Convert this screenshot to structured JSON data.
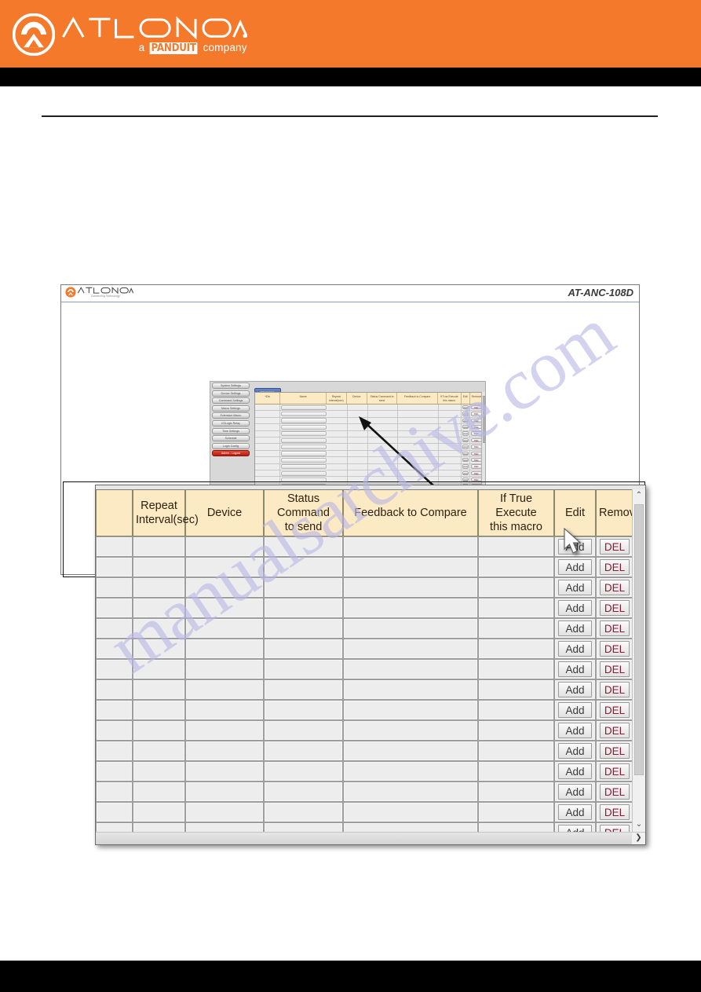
{
  "brand": {
    "logo_name": "atlona-logo",
    "wordmark": "ATLONA",
    "tagline_a": "a",
    "tagline_panduit": "PANDUIT",
    "tagline_company": "company",
    "orange": "#f4792b"
  },
  "watermark": {
    "text": "manualsarchive.com",
    "color": "#b9b7e6"
  },
  "device_ui": {
    "model": "AT-ANC-108D",
    "mini_logo_word": "ATLONA",
    "mini_logo_tagline": "Connecting Technology"
  },
  "inner_app": {
    "sidebar": {
      "items": [
        {
          "label": "System Settings"
        },
        {
          "label": "Device Settings"
        },
        {
          "label": "Command Settings"
        },
        {
          "label": "Macro Settings"
        },
        {
          "label": "Extension Macro"
        },
        {
          "label": "IO/Logic Relay"
        },
        {
          "label": "Time Settings"
        },
        {
          "label": "Schedule"
        },
        {
          "label": "Login Config"
        }
      ],
      "logout": "Admin - Logout"
    },
    "tab": "Message",
    "headers": [
      "+Div",
      "Name",
      "Repeat Interval(sec)",
      "Device",
      "Status Command to send",
      "Feedback to Compare",
      "If True Execute this macro",
      "Edit",
      "Remove"
    ],
    "row_count": 15,
    "add_label": "Add",
    "del_label": "DEL"
  },
  "zoom_panel": {
    "headers": [
      "",
      "Repeat Interval(sec)",
      "Device",
      "Status Command to send",
      "Feedback to Compare",
      "If True Execute this macro",
      "Edit",
      "Remove"
    ],
    "header_lines": [
      [
        "",
        ""
      ],
      [
        "Repeat",
        "Interval(sec)"
      ],
      [
        "Device",
        ""
      ],
      [
        "Status Command",
        "to send"
      ],
      [
        "Feedback to Compare",
        ""
      ],
      [
        "If True Execute",
        "this macro"
      ],
      [
        "Edit",
        ""
      ],
      [
        "Remove",
        ""
      ]
    ],
    "rows": [
      {
        "c0": "",
        "c1": "",
        "c2": "",
        "c3": "",
        "c4": "",
        "c5": "",
        "edit": "Add",
        "remove": "DEL"
      },
      {
        "c0": "",
        "c1": "",
        "c2": "",
        "c3": "",
        "c4": "",
        "c5": "",
        "edit": "Add",
        "remove": "DEL"
      },
      {
        "c0": "",
        "c1": "",
        "c2": "",
        "c3": "",
        "c4": "",
        "c5": "",
        "edit": "Add",
        "remove": "DEL"
      },
      {
        "c0": "",
        "c1": "",
        "c2": "",
        "c3": "",
        "c4": "",
        "c5": "",
        "edit": "Add",
        "remove": "DEL"
      },
      {
        "c0": "",
        "c1": "",
        "c2": "",
        "c3": "",
        "c4": "",
        "c5": "",
        "edit": "Add",
        "remove": "DEL"
      },
      {
        "c0": "",
        "c1": "",
        "c2": "",
        "c3": "",
        "c4": "",
        "c5": "",
        "edit": "Add",
        "remove": "DEL"
      },
      {
        "c0": "",
        "c1": "",
        "c2": "",
        "c3": "",
        "c4": "",
        "c5": "",
        "edit": "Add",
        "remove": "DEL"
      },
      {
        "c0": "",
        "c1": "",
        "c2": "",
        "c3": "",
        "c4": "",
        "c5": "",
        "edit": "Add",
        "remove": "DEL"
      },
      {
        "c0": "",
        "c1": "",
        "c2": "",
        "c3": "",
        "c4": "",
        "c5": "",
        "edit": "Add",
        "remove": "DEL"
      },
      {
        "c0": "",
        "c1": "",
        "c2": "",
        "c3": "",
        "c4": "",
        "c5": "",
        "edit": "Add",
        "remove": "DEL"
      },
      {
        "c0": "",
        "c1": "",
        "c2": "",
        "c3": "",
        "c4": "",
        "c5": "",
        "edit": "Add",
        "remove": "DEL"
      },
      {
        "c0": "",
        "c1": "",
        "c2": "",
        "c3": "",
        "c4": "",
        "c5": "",
        "edit": "Add",
        "remove": "DEL"
      },
      {
        "c0": "",
        "c1": "",
        "c2": "",
        "c3": "",
        "c4": "",
        "c5": "",
        "edit": "Add",
        "remove": "DEL"
      },
      {
        "c0": "",
        "c1": "",
        "c2": "",
        "c3": "",
        "c4": "",
        "c5": "",
        "edit": "Add",
        "remove": "DEL"
      },
      {
        "c0": "",
        "c1": "",
        "c2": "",
        "c3": "",
        "c4": "",
        "c5": "",
        "edit": "Add",
        "remove": "DEL"
      }
    ],
    "scroll_up_glyph": "⌃",
    "scroll_down_glyph": "⌄",
    "scroll_right_glyph": "❯"
  }
}
